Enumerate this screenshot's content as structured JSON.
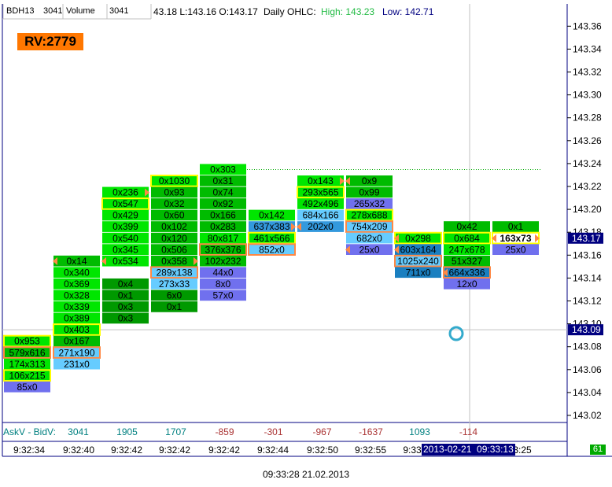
{
  "header": {
    "symbol": "BDH13",
    "symbol_value": "3041",
    "indicator_label": "Volume",
    "indicator_value": "3041",
    "ohlc_prefix": "43.18 L:143.16 O:143.17",
    "ohlc_label": "Daily OHLC:",
    "high_text": "High: 143.23",
    "low_text": "Low: 142.71"
  },
  "rv_badge": "RV:2779",
  "footer": {
    "delta_label": "AskV - BidV:",
    "corner_value": "61",
    "timestamp": "09:33:28 21.02.2013",
    "crosshair_time": "2013-02-21  09:33:13"
  },
  "colors": {
    "bright_green": "#00e600",
    "mid_green": "#00bb00",
    "dark_green": "#009900",
    "light_blue": "#66ccff",
    "steel_blue": "#3399dd",
    "dark_blue": "#1a7fc0",
    "violet": "#7070ee",
    "yellow_border": "#ffff00",
    "orange_border": "#ff8844",
    "rv_badge": "#ff7700",
    "axis_blue": "#000080"
  },
  "chart_data": {
    "type": "footprint",
    "y_ticks": [
      "143.36",
      "143.34",
      "143.32",
      "143.30",
      "143.28",
      "143.26",
      "143.24",
      "143.22",
      "143.20",
      "143.18",
      "143.16",
      "143.14",
      "143.12",
      "143.10",
      "143.08",
      "143.06",
      "143.04",
      "143.02"
    ],
    "ylim": [
      143.01,
      143.375
    ],
    "last_price": "143.17",
    "crosshair_price": "143.09",
    "time_labels": [
      "9:32:34",
      "9:32:40",
      "9:32:42",
      "9:32:42",
      "9:32:42",
      "9:32:44",
      "9:32:50",
      "9:32:55",
      "9:33",
      "",
      "3:25"
    ],
    "deltas": [
      "",
      "3041",
      "1905",
      "1707",
      "-859",
      "-301",
      "-967",
      "-1637",
      "1093",
      "-114"
    ],
    "bars": [
      {
        "cells": [
          {
            "p": 143.08,
            "t": "0x953",
            "c": "bright",
            "b": "yellow"
          },
          {
            "p": 143.07,
            "t": "579x616",
            "c": "green",
            "b": "orange"
          },
          {
            "p": 143.06,
            "t": "174x313",
            "c": "bright"
          },
          {
            "p": 143.05,
            "t": "106x215",
            "c": "bright",
            "b": "yellow"
          },
          {
            "p": 143.04,
            "t": "85x0",
            "c": "violet"
          }
        ]
      },
      {
        "cells": [
          {
            "p": 143.15,
            "t": "0x14",
            "c": "green",
            "m": "left"
          },
          {
            "p": 143.14,
            "t": "0x340",
            "c": "bright"
          },
          {
            "p": 143.13,
            "t": "0x369",
            "c": "bright"
          },
          {
            "p": 143.12,
            "t": "0x328",
            "c": "bright"
          },
          {
            "p": 143.11,
            "t": "0x339",
            "c": "bright"
          },
          {
            "p": 143.1,
            "t": "0x389",
            "c": "bright"
          },
          {
            "p": 143.09,
            "t": "0x403",
            "c": "bright",
            "b": "yellow"
          },
          {
            "p": 143.08,
            "t": "0x167",
            "c": "green"
          },
          {
            "p": 143.07,
            "t": "271x190",
            "c": "lightblue",
            "b": "orange"
          },
          {
            "p": 143.06,
            "t": "231x0",
            "c": "lightblue"
          }
        ]
      },
      {
        "cells": [
          {
            "p": 143.21,
            "t": "0x236",
            "c": "bright",
            "m": "right"
          },
          {
            "p": 143.2,
            "t": "0x547",
            "c": "bright",
            "b": "yellow"
          },
          {
            "p": 143.19,
            "t": "0x429",
            "c": "bright"
          },
          {
            "p": 143.18,
            "t": "0x399",
            "c": "bright"
          },
          {
            "p": 143.17,
            "t": "0x540",
            "c": "bright"
          },
          {
            "p": 143.16,
            "t": "0x345",
            "c": "bright"
          },
          {
            "p": 143.15,
            "t": "0x534",
            "c": "bright",
            "m": "left"
          },
          {
            "p": 143.13,
            "t": "0x4",
            "c": "dark"
          },
          {
            "p": 143.12,
            "t": "0x1",
            "c": "dark"
          },
          {
            "p": 143.11,
            "t": "0x3",
            "c": "dark"
          },
          {
            "p": 143.1,
            "t": "0x3",
            "c": "dark"
          }
        ]
      },
      {
        "cells": [
          {
            "p": 143.22,
            "t": "0x1030",
            "c": "bright",
            "b": "yellow"
          },
          {
            "p": 143.21,
            "t": "0x93",
            "c": "green"
          },
          {
            "p": 143.2,
            "t": "0x32",
            "c": "green"
          },
          {
            "p": 143.19,
            "t": "0x60",
            "c": "green"
          },
          {
            "p": 143.18,
            "t": "0x102",
            "c": "green"
          },
          {
            "p": 143.17,
            "t": "0x120",
            "c": "green"
          },
          {
            "p": 143.16,
            "t": "0x506",
            "c": "green"
          },
          {
            "p": 143.15,
            "t": "0x358",
            "c": "green",
            "m": "right"
          },
          {
            "p": 143.14,
            "t": "289x138",
            "c": "lightblue",
            "b": "orange"
          },
          {
            "p": 143.13,
            "t": "273x33",
            "c": "lightblue"
          },
          {
            "p": 143.12,
            "t": "6x0",
            "c": "dark"
          },
          {
            "p": 143.11,
            "t": "0x1",
            "c": "dark"
          }
        ]
      },
      {
        "cells": [
          {
            "p": 143.23,
            "t": "0x303",
            "c": "bright"
          },
          {
            "p": 143.22,
            "t": "0x31",
            "c": "green"
          },
          {
            "p": 143.21,
            "t": "0x74",
            "c": "green"
          },
          {
            "p": 143.2,
            "t": "0x92",
            "c": "green"
          },
          {
            "p": 143.19,
            "t": "0x166",
            "c": "green"
          },
          {
            "p": 143.18,
            "t": "0x283",
            "c": "green"
          },
          {
            "p": 143.17,
            "t": "80x817",
            "c": "bright"
          },
          {
            "p": 143.16,
            "t": "376x376",
            "c": "green",
            "b": "orange"
          },
          {
            "p": 143.15,
            "t": "102x232",
            "c": "green"
          },
          {
            "p": 143.14,
            "t": "44x0",
            "c": "violet"
          },
          {
            "p": 143.13,
            "t": "8x0",
            "c": "violet"
          },
          {
            "p": 143.12,
            "t": "57x0",
            "c": "violet"
          }
        ]
      },
      {
        "cells": [
          {
            "p": 143.19,
            "t": "0x142",
            "c": "bright"
          },
          {
            "p": 143.18,
            "t": "637x383",
            "c": "steel",
            "m": "right"
          },
          {
            "p": 143.17,
            "t": "461x566",
            "c": "bright",
            "b": "yellow"
          },
          {
            "p": 143.16,
            "t": "852x0",
            "c": "lightblue",
            "b": "orange"
          }
        ]
      },
      {
        "cells": [
          {
            "p": 143.22,
            "t": "0x143",
            "c": "bright",
            "m": "right"
          },
          {
            "p": 143.21,
            "t": "293x565",
            "c": "bright",
            "b": "yellow"
          },
          {
            "p": 143.2,
            "t": "492x496",
            "c": "bright"
          },
          {
            "p": 143.19,
            "t": "684x166",
            "c": "lightblue"
          },
          {
            "p": 143.18,
            "t": "202x0",
            "c": "steel",
            "m": "left"
          }
        ]
      },
      {
        "cells": [
          {
            "p": 143.22,
            "t": "0x9",
            "c": "green",
            "m": "left"
          },
          {
            "p": 143.21,
            "t": "0x99",
            "c": "green"
          },
          {
            "p": 143.2,
            "t": "265x32",
            "c": "violet"
          },
          {
            "p": 143.19,
            "t": "278x688",
            "c": "bright",
            "b": "yellow"
          },
          {
            "p": 143.18,
            "t": "754x209",
            "c": "lightblue",
            "b": "orange"
          },
          {
            "p": 143.17,
            "t": "682x0",
            "c": "lightblue"
          },
          {
            "p": 143.16,
            "t": "25x0",
            "c": "violet",
            "m": "left"
          }
        ]
      },
      {
        "cells": [
          {
            "p": 143.17,
            "t": "0x298",
            "c": "bright",
            "b": "yellow",
            "m": "left"
          },
          {
            "p": 143.16,
            "t": "603x164",
            "c": "dblue",
            "m": "left"
          },
          {
            "p": 143.15,
            "t": "1025x240",
            "c": "lightblue",
            "b": "orange"
          },
          {
            "p": 143.14,
            "t": "711x0",
            "c": "dblue"
          }
        ]
      },
      {
        "cells": [
          {
            "p": 143.18,
            "t": "0x42",
            "c": "green"
          },
          {
            "p": 143.17,
            "t": "0x684",
            "c": "bright",
            "b": "yellow"
          },
          {
            "p": 143.16,
            "t": "247x678",
            "c": "bright"
          },
          {
            "p": 143.15,
            "t": "51x327",
            "c": "green"
          },
          {
            "p": 143.14,
            "t": "664x336",
            "c": "dblue",
            "b": "orange",
            "m": "left"
          },
          {
            "p": 143.13,
            "t": "12x0",
            "c": "violet"
          }
        ]
      },
      {
        "cells": [
          {
            "p": 143.18,
            "t": "0x1",
            "c": "green"
          },
          {
            "p": 143.17,
            "t": "163x73",
            "c": "white",
            "b": "yellow",
            "m": "both"
          },
          {
            "p": 143.16,
            "t": "25x0",
            "c": "violet"
          }
        ]
      }
    ]
  }
}
